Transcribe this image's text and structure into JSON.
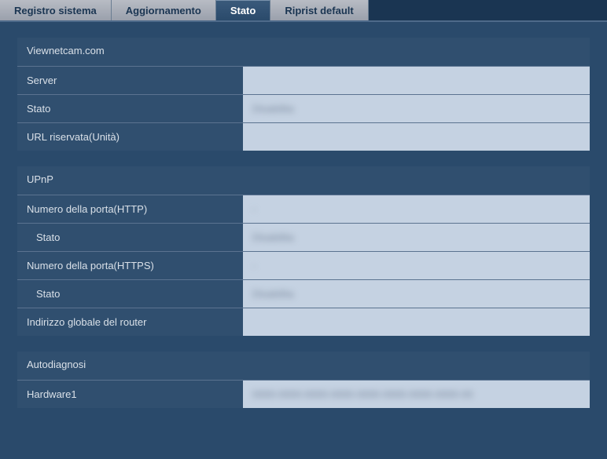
{
  "tabs": {
    "t0": "Registro sistema",
    "t1": "Aggiornamento",
    "t2": "Stato",
    "t3": "Riprist default"
  },
  "section_viewnetcam": {
    "header": "Viewnetcam.com",
    "server_label": "Server",
    "server_value": "",
    "stato_label": "Stato",
    "stato_value": "Disabilita",
    "url_label": "URL riservata(Unità)",
    "url_value": ""
  },
  "section_upnp": {
    "header": "UPnP",
    "http_port_label": "Numero della porta(HTTP)",
    "http_port_value": "-",
    "http_stato_label": "Stato",
    "http_stato_value": "Disabilita",
    "https_port_label": "Numero della porta(HTTPS)",
    "https_port_value": "-",
    "https_stato_label": "Stato",
    "https_stato_value": "Disabilita",
    "router_label": "Indirizzo globale del router",
    "router_value": ""
  },
  "section_autodiag": {
    "header": "Autodiagnosi",
    "hw_label": "Hardware1",
    "hw_value": "0000-0000-0000-0000-0000-0000-0000-0000-00"
  }
}
